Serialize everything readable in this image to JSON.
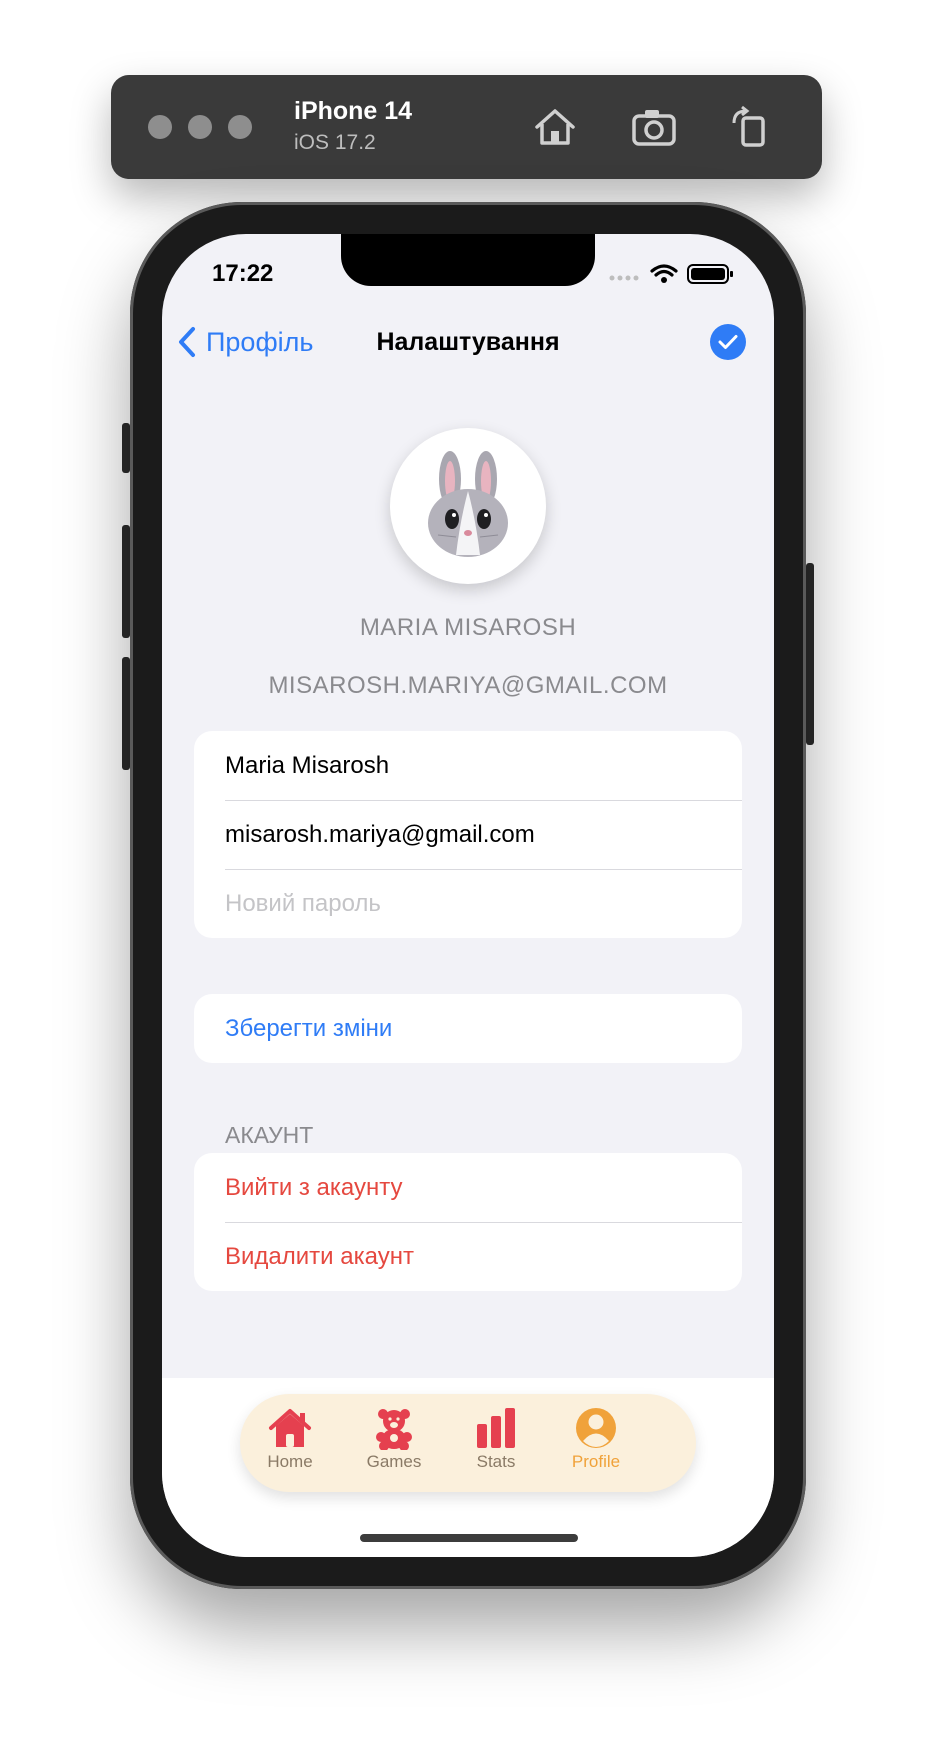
{
  "simulator": {
    "device": "iPhone 14",
    "os": "iOS 17.2",
    "icons": [
      "home-icon",
      "camera-icon",
      "rotate-icon"
    ]
  },
  "status_bar": {
    "time": "17:22"
  },
  "nav": {
    "back_label": "Профіль",
    "title": "Налаштування",
    "confirm_icon": "checkmark-circle-icon"
  },
  "profile": {
    "avatar_icon": "rabbit-avatar-icon",
    "name_display": "MARIA MISAROSH",
    "email_display": "MISAROSH.MARIYA@GMAIL.COM"
  },
  "form": {
    "name_value": "Maria Misarosh",
    "email_value": "misarosh.mariya@gmail.com",
    "password_placeholder": "Новий пароль"
  },
  "actions": {
    "save_label": "Зберегти зміни"
  },
  "account": {
    "header": "АКАУНТ",
    "logout_label": "Вийти з акаунту",
    "delete_label": "Видалити акаунт"
  },
  "tabbar": {
    "active": "Profile",
    "items": [
      {
        "label": "Home",
        "icon": "house-icon"
      },
      {
        "label": "Games",
        "icon": "teddy-bear-icon"
      },
      {
        "label": "Stats",
        "icon": "bar-chart-icon"
      },
      {
        "label": "Profile",
        "icon": "person-circle-icon"
      }
    ]
  },
  "colors": {
    "accent_blue": "#2f7cf6",
    "destructive_red": "#e5483f",
    "tab_red": "#e5404f",
    "tab_active_orange": "#f0a23a",
    "tab_pill_bg": "#fbf0dc",
    "background": "#f2f2f7"
  }
}
